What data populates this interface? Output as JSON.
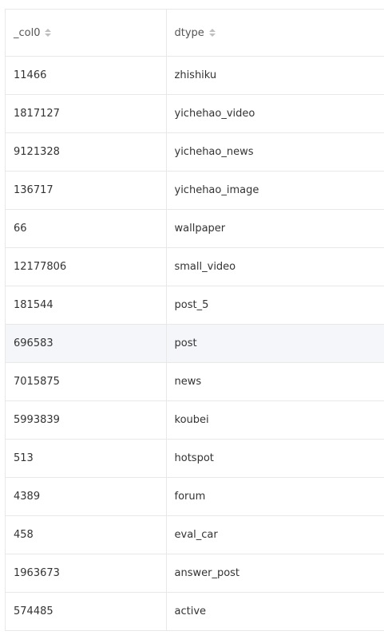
{
  "table": {
    "columns": [
      {
        "label": "_col0",
        "sort_icon": "sort-icon"
      },
      {
        "label": "dtype",
        "sort_icon": "sort-icon"
      }
    ],
    "rows": [
      {
        "col0": "11466",
        "dtype": "zhishiku"
      },
      {
        "col0": "1817127",
        "dtype": "yichehao_video"
      },
      {
        "col0": "9121328",
        "dtype": "yichehao_news"
      },
      {
        "col0": "136717",
        "dtype": "yichehao_image"
      },
      {
        "col0": "66",
        "dtype": "wallpaper"
      },
      {
        "col0": "12177806",
        "dtype": "small_video"
      },
      {
        "col0": "181544",
        "dtype": "post_5"
      },
      {
        "col0": "696583",
        "dtype": "post"
      },
      {
        "col0": "7015875",
        "dtype": "news"
      },
      {
        "col0": "5993839",
        "dtype": "koubei"
      },
      {
        "col0": "513",
        "dtype": "hotspot"
      },
      {
        "col0": "4389",
        "dtype": "forum"
      },
      {
        "col0": "458",
        "dtype": "eval_car"
      },
      {
        "col0": "1963673",
        "dtype": "answer_post"
      },
      {
        "col0": "574485",
        "dtype": "active"
      }
    ],
    "hovered_row_index": 7
  },
  "colors": {
    "border": "#e8e8e8",
    "hover_row": "#f5f6fa",
    "text": "#333333",
    "sort_icon": "#bfbfbf"
  }
}
